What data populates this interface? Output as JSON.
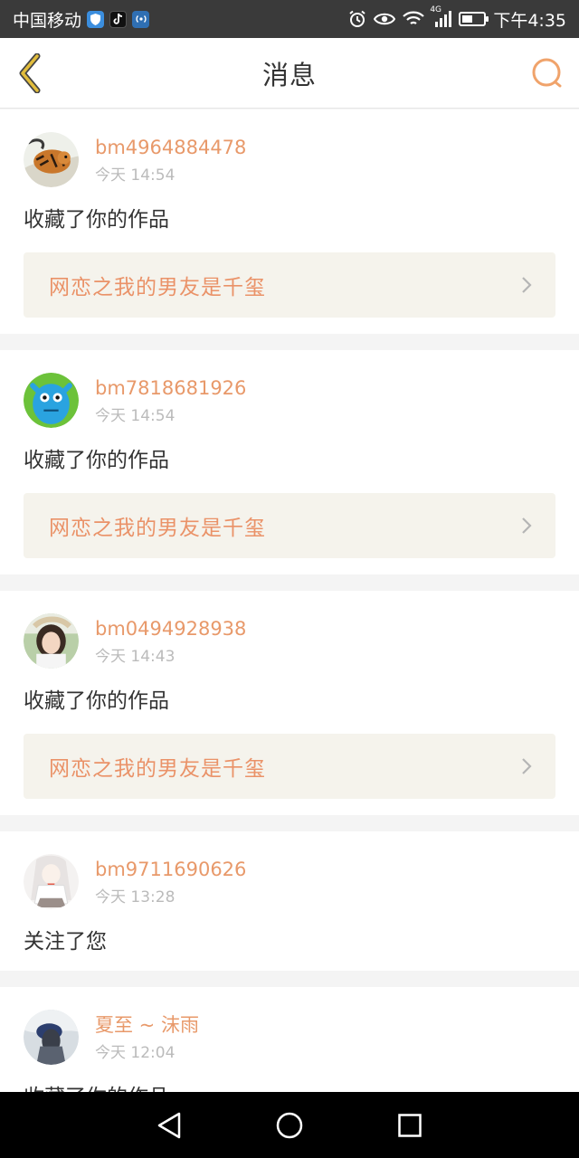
{
  "status_bar": {
    "carrier": "中国移动",
    "network": "4G",
    "time": "下午4:35",
    "battery_level": 0.5
  },
  "header": {
    "title": "消息"
  },
  "messages": [
    {
      "username": "bm4964884478",
      "time": "今天 14:54",
      "action": "收藏了你的作品",
      "work_title": "网恋之我的男友是千玺"
    },
    {
      "username": "bm7818681926",
      "time": "今天 14:54",
      "action": "收藏了你的作品",
      "work_title": "网恋之我的男友是千玺"
    },
    {
      "username": "bm0494928938",
      "time": "今天 14:43",
      "action": "收藏了你的作品",
      "work_title": "网恋之我的男友是千玺"
    },
    {
      "username": "bm9711690626",
      "time": "今天 13:28",
      "action": "关注了您"
    },
    {
      "username": "夏至 ~ 沫雨",
      "time": "今天 12:04",
      "action": "收藏了你的作品"
    }
  ],
  "colors": {
    "accent": "#e8996a",
    "back_icon": "#d9b23a",
    "work_bg": "#f5f3ec"
  }
}
